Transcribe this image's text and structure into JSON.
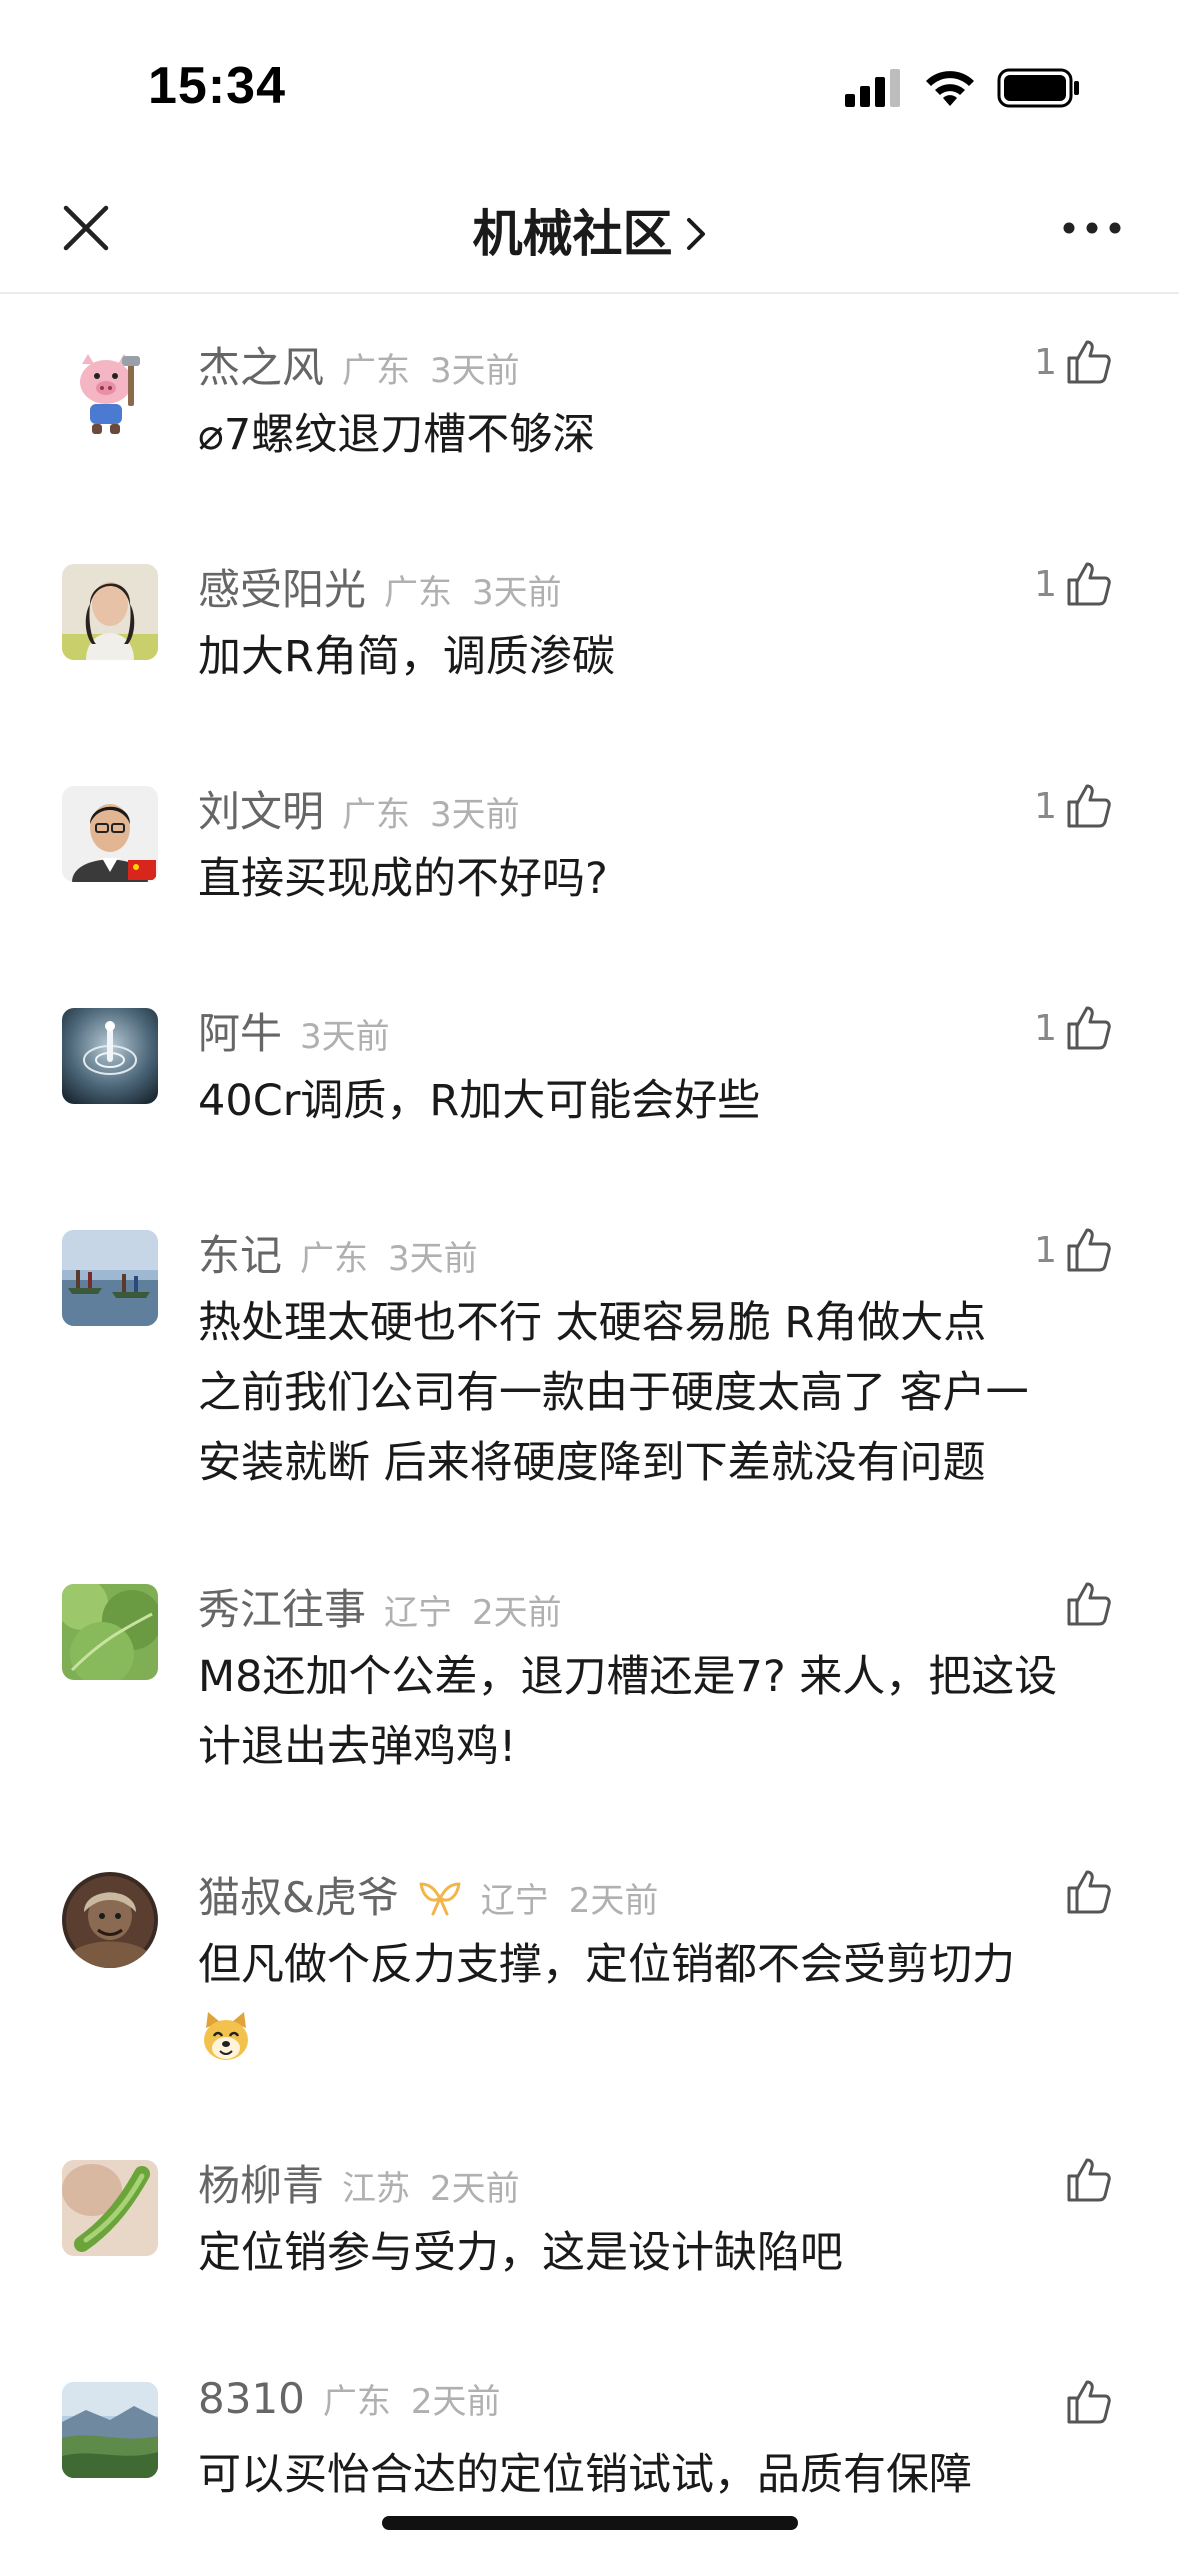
{
  "status_bar": {
    "time": "15:34"
  },
  "nav": {
    "title": "机械社区",
    "close_icon": "close-icon",
    "more_icon": "more-icon"
  },
  "comments": [
    {
      "name": "杰之风",
      "region": "广东",
      "time": "3天前",
      "likes": "1",
      "lines": [
        "⌀7螺纹退刀槽不够深"
      ]
    },
    {
      "name": "感受阳光",
      "region": "广东",
      "time": "3天前",
      "likes": "1",
      "lines": [
        "加大R角简，调质渗碳"
      ]
    },
    {
      "name": "刘文明",
      "region": "广东",
      "time": "3天前",
      "likes": "1",
      "lines": [
        "直接买现成的不好吗?"
      ]
    },
    {
      "name": "阿牛",
      "region": "",
      "time": "3天前",
      "likes": "1",
      "lines": [
        "40Cr调质，R加大可能会好些"
      ]
    },
    {
      "name": "东记",
      "region": "广东",
      "time": "3天前",
      "likes": "1",
      "lines": [
        "热处理太硬也不行 太硬容易脆  R角做大点",
        "之前我们公司有一款由于硬度太高了 客户一",
        "安装就断   后来将硬度降到下差就没有问题"
      ]
    },
    {
      "name": "秀江往事",
      "region": "辽宁",
      "time": "2天前",
      "likes": "",
      "lines": [
        "M8还加个公差，退刀槽还是7? 来人，把这设",
        "计退出去弹鸡鸡!"
      ]
    },
    {
      "name": "猫叔&虎爷",
      "region": "辽宁",
      "time": "2天前",
      "likes": "",
      "lines": [
        "但凡做个反力支撑，定位销都不会受剪切力"
      ]
    },
    {
      "name": "杨柳青",
      "region": "江苏",
      "time": "2天前",
      "likes": "",
      "lines": [
        "定位销参与受力，这是设计缺陷吧"
      ]
    },
    {
      "name": "8310",
      "region": "广东",
      "time": "2天前",
      "likes": "",
      "lines": [
        "可以买怡合达的定位销试试，品质有保障"
      ]
    }
  ],
  "colors": {
    "name": "#666666",
    "meta": "#b0b0b0",
    "text": "#1a1a1a",
    "divider": "#ececec"
  }
}
